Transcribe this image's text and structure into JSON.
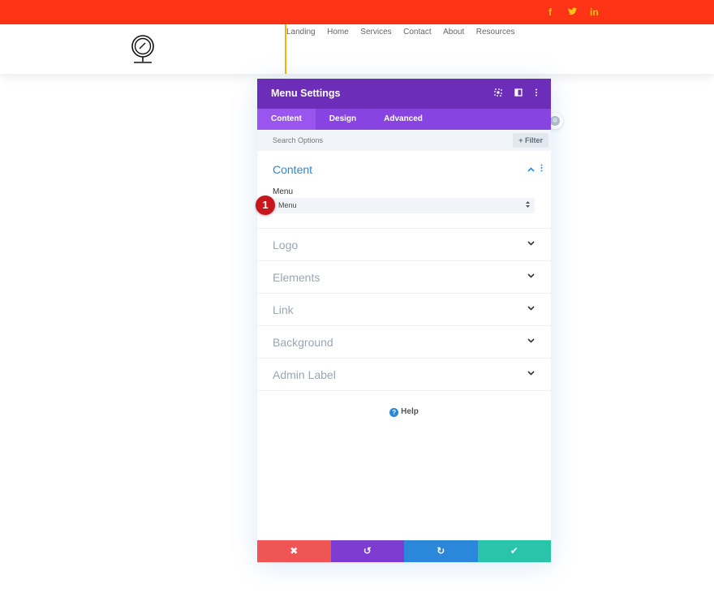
{
  "colors": {
    "topbar": "#ff3316",
    "social": "#ffc21a",
    "header_divider": "#f4b400",
    "modal_header": "#6c2eb9",
    "modal_tabs": "#8844e0",
    "accent_blue": "#2b87da",
    "discard": "#ef5555",
    "undo": "#7e3bd0",
    "redo": "#2b87da",
    "save": "#29c4a9",
    "badge": "#c8161d"
  },
  "topbar": {
    "social": [
      {
        "icon": "facebook-icon",
        "glyph": "f"
      },
      {
        "icon": "twitter-icon",
        "glyph": "🐦"
      },
      {
        "icon": "linkedin-icon",
        "glyph": "in"
      }
    ]
  },
  "header": {
    "logo_icon": "mirror-icon",
    "nav": [
      "Landing",
      "Home",
      "Services",
      "Contact",
      "About",
      "Resources"
    ]
  },
  "modal": {
    "title": "Menu Settings",
    "header_icons": [
      "expand-icon",
      "split-view-icon",
      "more-icon"
    ],
    "tabs": [
      "Content",
      "Design",
      "Advanced"
    ],
    "active_tab": "Content",
    "search": {
      "placeholder": "Search Options"
    },
    "filter_label": "+ Filter",
    "content_section": {
      "title": "Content",
      "field_label": "Menu",
      "select_value": "Menu"
    },
    "badge": "1",
    "sections": [
      "Logo",
      "Elements",
      "Link",
      "Background",
      "Admin Label"
    ],
    "help_label": "Help",
    "footer": {
      "discard": "✖",
      "undo": "↺",
      "redo": "↻",
      "save": "✔"
    }
  }
}
